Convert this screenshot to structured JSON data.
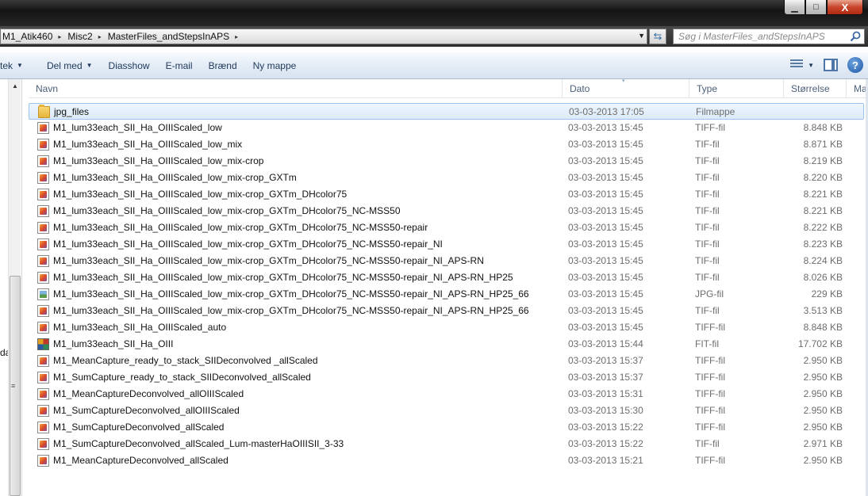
{
  "window": {
    "minimize_glyph": "▁",
    "maximize_glyph": "□",
    "close_glyph": "X"
  },
  "address": {
    "crumbs": [
      "M1_Atik460",
      "Misc2",
      "MasterFiles_andStepsInAPS"
    ],
    "separator": "▸",
    "dropdown_glyph": "▼",
    "refresh_glyph": "⇆"
  },
  "search": {
    "placeholder": "Søg i MasterFiles_andStepsInAPS"
  },
  "toolbar": {
    "organize_label": "tek",
    "share_label": "Del med",
    "slideshow_label": "Diasshow",
    "email_label": "E-mail",
    "burn_label": "Brænd",
    "new_folder_label": "Ny mappe",
    "caret": "▼",
    "help_glyph": "?"
  },
  "nav": {
    "partial_label": "da",
    "scroll_up_glyph": "▲",
    "grip_glyph": "≡"
  },
  "columns": {
    "name": "Navn",
    "date": "Dato",
    "type": "Type",
    "size": "Størrelse",
    "extra": "Ma"
  },
  "files": [
    {
      "name": "jpg_files",
      "date": "03-03-2013 17:05",
      "type": "Filmappe",
      "size": "",
      "icon": "folder-icon",
      "selected": true
    },
    {
      "name": "M1_lum33each_SII_Ha_OIIIScaled_low",
      "date": "03-03-2013 15:45",
      "type": "TIFF-fil",
      "size": "8.848 KB",
      "icon": "tiff-file-icon"
    },
    {
      "name": "M1_lum33each_SII_Ha_OIIIScaled_low_mix",
      "date": "03-03-2013 15:45",
      "type": "TIF-fil",
      "size": "8.871 KB",
      "icon": "tiff-file-icon"
    },
    {
      "name": "M1_lum33each_SII_Ha_OIIIScaled_low_mix-crop",
      "date": "03-03-2013 15:45",
      "type": "TIF-fil",
      "size": "8.219 KB",
      "icon": "tiff-file-icon"
    },
    {
      "name": "M1_lum33each_SII_Ha_OIIIScaled_low_mix-crop_GXTm",
      "date": "03-03-2013 15:45",
      "type": "TIF-fil",
      "size": "8.220 KB",
      "icon": "tiff-file-icon"
    },
    {
      "name": "M1_lum33each_SII_Ha_OIIIScaled_low_mix-crop_GXTm_DHcolor75",
      "date": "03-03-2013 15:45",
      "type": "TIF-fil",
      "size": "8.221 KB",
      "icon": "tiff-file-icon"
    },
    {
      "name": "M1_lum33each_SII_Ha_OIIIScaled_low_mix-crop_GXTm_DHcolor75_NC-MSS50",
      "date": "03-03-2013 15:45",
      "type": "TIF-fil",
      "size": "8.221 KB",
      "icon": "tiff-file-icon"
    },
    {
      "name": "M1_lum33each_SII_Ha_OIIIScaled_low_mix-crop_GXTm_DHcolor75_NC-MSS50-repair",
      "date": "03-03-2013 15:45",
      "type": "TIF-fil",
      "size": "8.222 KB",
      "icon": "tiff-file-icon"
    },
    {
      "name": "M1_lum33each_SII_Ha_OIIIScaled_low_mix-crop_GXTm_DHcolor75_NC-MSS50-repair_NI",
      "date": "03-03-2013 15:45",
      "type": "TIF-fil",
      "size": "8.223 KB",
      "icon": "tiff-file-icon"
    },
    {
      "name": "M1_lum33each_SII_Ha_OIIIScaled_low_mix-crop_GXTm_DHcolor75_NC-MSS50-repair_NI_APS-RN",
      "date": "03-03-2013 15:45",
      "type": "TIF-fil",
      "size": "8.224 KB",
      "icon": "tiff-file-icon"
    },
    {
      "name": "M1_lum33each_SII_Ha_OIIIScaled_low_mix-crop_GXTm_DHcolor75_NC-MSS50-repair_NI_APS-RN_HP25",
      "date": "03-03-2013 15:45",
      "type": "TIF-fil",
      "size": "8.026 KB",
      "icon": "tiff-file-icon"
    },
    {
      "name": "M1_lum33each_SII_Ha_OIIIScaled_low_mix-crop_GXTm_DHcolor75_NC-MSS50-repair_NI_APS-RN_HP25_66",
      "date": "03-03-2013 15:45",
      "type": "JPG-fil",
      "size": "229 KB",
      "icon": "jpg-file-icon"
    },
    {
      "name": "M1_lum33each_SII_Ha_OIIIScaled_low_mix-crop_GXTm_DHcolor75_NC-MSS50-repair_NI_APS-RN_HP25_66",
      "date": "03-03-2013 15:45",
      "type": "TIF-fil",
      "size": "3.513 KB",
      "icon": "tiff-file-icon"
    },
    {
      "name": "M1_lum33each_SII_Ha_OIIIScaled_auto",
      "date": "03-03-2013 15:45",
      "type": "TIFF-fil",
      "size": "8.848 KB",
      "icon": "tiff-file-icon"
    },
    {
      "name": "M1_lum33each_SII_Ha_OIII",
      "date": "03-03-2013 15:44",
      "type": "FIT-fil",
      "size": "17.702 KB",
      "icon": "fit-file-icon"
    },
    {
      "name": "M1_MeanCapture_ready_to_stack_SIIDeconvolved _allScaled",
      "date": "03-03-2013 15:37",
      "type": "TIFF-fil",
      "size": "2.950 KB",
      "icon": "tiff-file-icon"
    },
    {
      "name": "M1_SumCapture_ready_to_stack_SIIDeconvolved_allScaled",
      "date": "03-03-2013 15:37",
      "type": "TIFF-fil",
      "size": "2.950 KB",
      "icon": "tiff-file-icon"
    },
    {
      "name": "M1_MeanCaptureDeconvolved_allOIIIScaled",
      "date": "03-03-2013 15:31",
      "type": "TIFF-fil",
      "size": "2.950 KB",
      "icon": "tiff-file-icon"
    },
    {
      "name": "M1_SumCaptureDeconvolved_allOIIIScaled",
      "date": "03-03-2013 15:30",
      "type": "TIFF-fil",
      "size": "2.950 KB",
      "icon": "tiff-file-icon"
    },
    {
      "name": "M1_SumCaptureDeconvolved_allScaled",
      "date": "03-03-2013 15:22",
      "type": "TIFF-fil",
      "size": "2.950 KB",
      "icon": "tiff-file-icon"
    },
    {
      "name": "M1_SumCaptureDeconvolved_allScaled_Lum-masterHaOIIISII_3-33",
      "date": "03-03-2013 15:22",
      "type": "TIF-fil",
      "size": "2.971 KB",
      "icon": "tiff-file-icon"
    },
    {
      "name": "M1_MeanCaptureDeconvolved_allScaled",
      "date": "03-03-2013 15:21",
      "type": "TIFF-fil",
      "size": "2.950 KB",
      "icon": "tiff-file-icon"
    }
  ]
}
